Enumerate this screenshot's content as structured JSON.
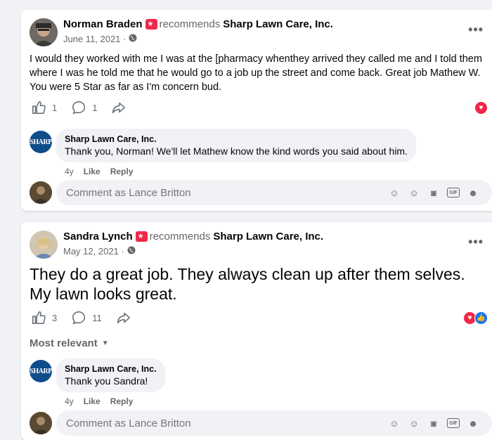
{
  "posts": [
    {
      "author": "Norman Braden",
      "recommends": "recommends",
      "page": "Sharp Lawn Care, Inc.",
      "date": "June 11, 2021 ·",
      "text": "I would they worked with me I was at the [pharmacy whenthey arrived they called me and I told them where I was he told me that he would go to a job up the street and come back. Great job Mathew W. You were 5 Star as far as I'm concern bud.",
      "likes": "1",
      "comments": "1",
      "reply": {
        "author": "Sharp Lawn Care, Inc.",
        "text": "Thank you, Norman! We'll let Mathew know the kind words you said about him.",
        "age": "4y",
        "like_label": "Like",
        "reply_label": "Reply"
      },
      "comment_placeholder": "Comment as Lance Britton"
    },
    {
      "author": "Sandra Lynch",
      "recommends": "recommends",
      "page": "Sharp Lawn Care, Inc.",
      "date": "May 12, 2021 ·",
      "text": "They do a great job. They always clean up after them selves. My lawn looks great.",
      "likes": "3",
      "comments": "11",
      "sort_label": "Most relevant",
      "reply": {
        "author": "Sharp Lawn Care, Inc.",
        "text": "Thank you Sandra!",
        "age": "4y",
        "like_label": "Like",
        "reply_label": "Reply"
      },
      "comment_placeholder": "Comment as Lance Britton"
    }
  ],
  "brand_logo_text": "SHARP",
  "colors": {
    "love": "#f02849",
    "like": "#1877f2",
    "brand": "#0f4c8a"
  }
}
